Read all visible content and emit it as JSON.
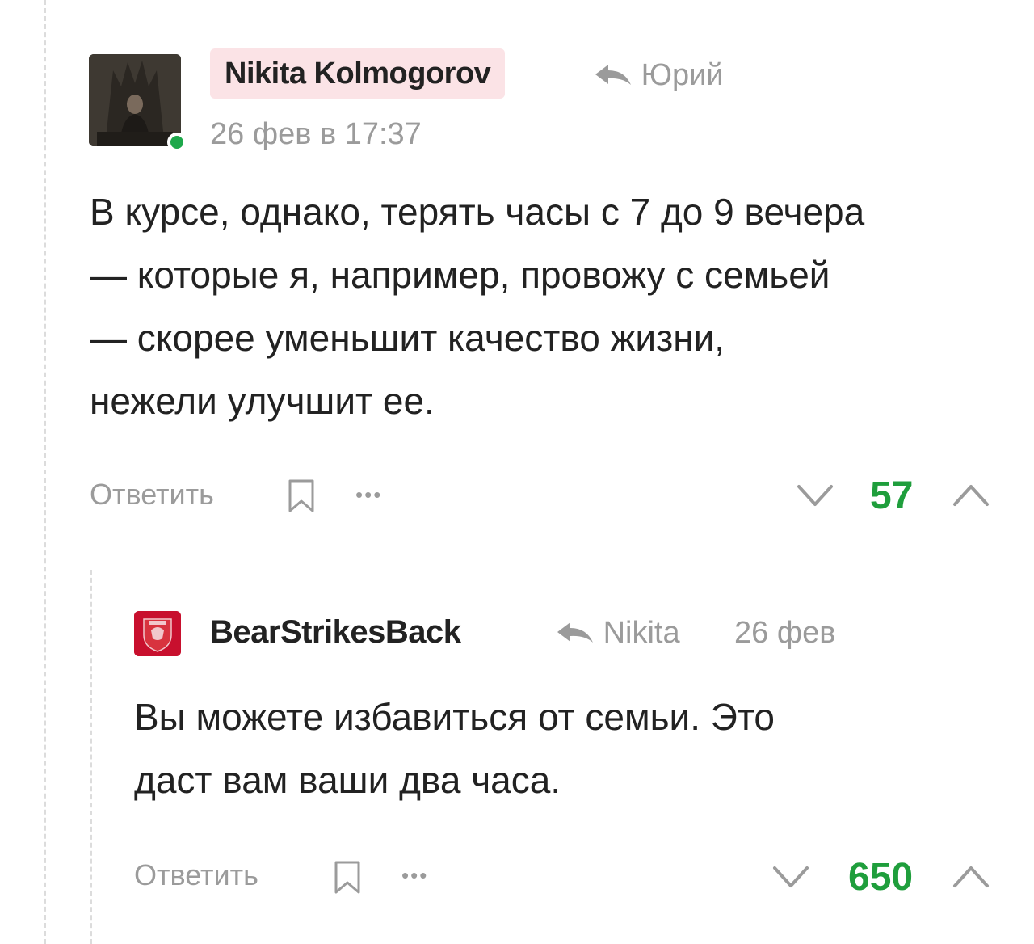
{
  "comment1": {
    "author": "Nikita Kolmogorov",
    "reply_to": "Юрий",
    "date": "26 фев в 17:37",
    "text_lines": [
      "В курсе, однако, терять часы с 7 до 9 вечера",
      "— которые я, например, провожу с семьей",
      "— скорее уменьшит качество жизни,",
      "нежели улучшит ее."
    ],
    "actions": {
      "reply": "Ответить",
      "more": "•••"
    },
    "score": "57",
    "colors": {
      "badge_bg": "#fbe3e6",
      "online": "#1ea84b",
      "score": "#1f9e3c"
    }
  },
  "comment2": {
    "author": "BearStrikesBack",
    "reply_to": "Nikita",
    "date": "26 фев",
    "text_lines": [
      "Вы можете избавиться от семьи. Это",
      "даст вам ваши два часа."
    ],
    "actions": {
      "reply": "Ответить",
      "more": "•••"
    },
    "score": "650",
    "colors": {
      "avatar_bg": "#c8102e",
      "score": "#1f9e3c"
    }
  },
  "icons": {
    "reply": "reply-arrow-icon",
    "bookmark": "bookmark-icon",
    "vote_down": "chevron-down-icon",
    "vote_up": "chevron-up-icon"
  }
}
